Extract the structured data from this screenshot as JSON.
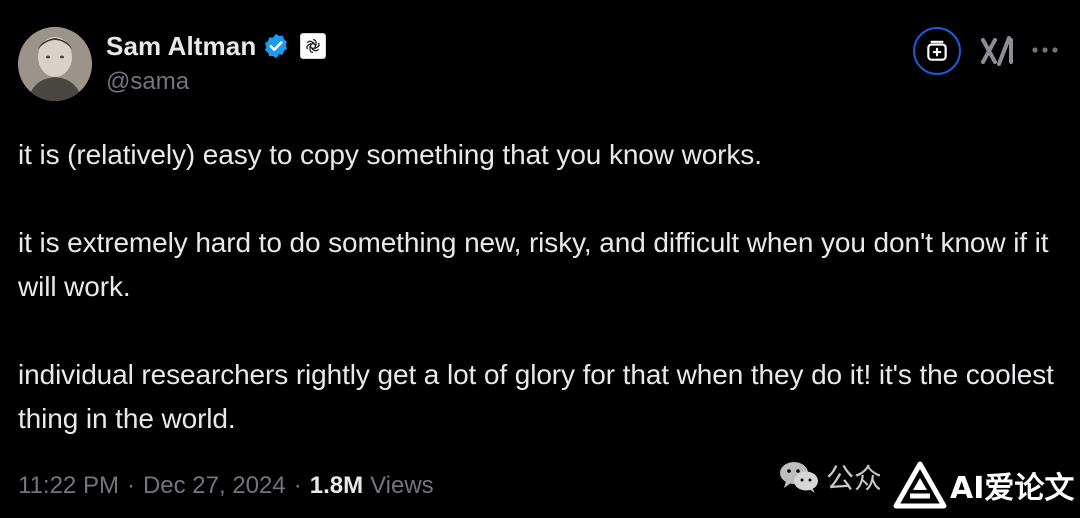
{
  "author": {
    "display_name": "Sam Altman",
    "handle": "@sama",
    "verified_icon": "verified-badge-icon",
    "affiliate_icon": "openai-logo-icon"
  },
  "actions": {
    "grok_icon": "grok-icon",
    "xai_icon": "xai-logo-icon",
    "more_icon": "more-options-icon"
  },
  "tweet": {
    "paragraphs": [
      "it is (relatively) easy to copy something that you know works.",
      "it is extremely hard to do something new, risky, and difficult when you don't know if it will work.",
      "individual researchers rightly get a lot of glory for that when they do it! it's the coolest thing in the world."
    ]
  },
  "meta": {
    "time": "11:22 PM",
    "separator": "·",
    "date": "Dec 27, 2024",
    "views_count": "1.8M",
    "views_label": "Views"
  },
  "watermark": {
    "text": "公众",
    "logo_text": "AI爱论文"
  },
  "colors": {
    "background": "#000000",
    "text_primary": "#e7e9ea",
    "text_secondary": "#71767b",
    "verified_blue": "#1d9bf0",
    "grok_ring": "#1d5bd6"
  }
}
